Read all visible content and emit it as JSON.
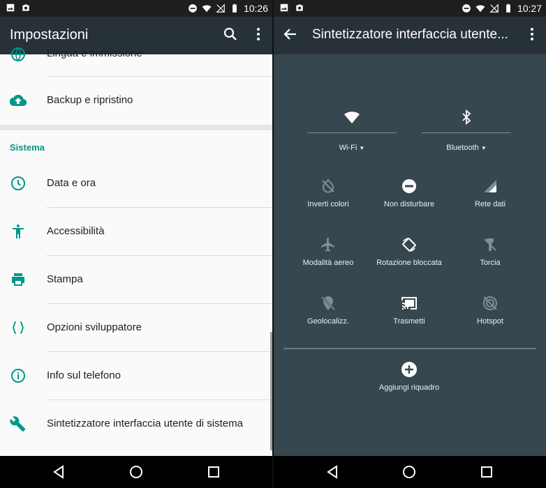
{
  "left": {
    "status": {
      "time": "10:26"
    },
    "appbar": {
      "title": "Impostazioni"
    },
    "items_top": [
      {
        "label": "Lingua e immissione",
        "icon": "globe-icon"
      },
      {
        "label": "Backup e ripristino",
        "icon": "cloud-upload-icon"
      }
    ],
    "section": {
      "title": "Sistema"
    },
    "items": [
      {
        "label": "Data e ora",
        "icon": "clock-icon"
      },
      {
        "label": "Accessibilità",
        "icon": "accessibility-icon"
      },
      {
        "label": "Stampa",
        "icon": "printer-icon"
      },
      {
        "label": "Opzioni sviluppatore",
        "icon": "braces-icon"
      },
      {
        "label": "Info sul telefono",
        "icon": "info-icon"
      },
      {
        "label": "Sintetizzatore interfaccia utente di sistema",
        "icon": "wrench-icon"
      }
    ]
  },
  "right": {
    "status": {
      "time": "10:27"
    },
    "appbar": {
      "title": "Sintetizzatore interfaccia utente..."
    },
    "big_tiles": [
      {
        "label": "Wi-Fi",
        "icon": "wifi-icon"
      },
      {
        "label": "Bluetooth",
        "icon": "bluetooth-icon"
      }
    ],
    "tiles": [
      {
        "label": "Inverti colori",
        "icon": "invert-colors-icon"
      },
      {
        "label": "Non disturbare",
        "icon": "do-not-disturb-icon"
      },
      {
        "label": "Rete dati",
        "icon": "cellular-data-icon"
      },
      {
        "label": "Modalità aereo",
        "icon": "airplane-icon"
      },
      {
        "label": "Rotazione bloccata",
        "icon": "rotation-lock-icon"
      },
      {
        "label": "Torcia",
        "icon": "flashlight-icon"
      },
      {
        "label": "Geolocalizz.",
        "icon": "location-off-icon"
      },
      {
        "label": "Trasmetti",
        "icon": "cast-icon"
      },
      {
        "label": "Hotspot",
        "icon": "hotspot-icon"
      }
    ],
    "add_tile": {
      "label": "Aggiungi riquadro",
      "icon": "add-circle-icon"
    }
  },
  "colors": {
    "accent": "#009688",
    "appbar": "#263238",
    "qs_bg": "#37474f"
  }
}
